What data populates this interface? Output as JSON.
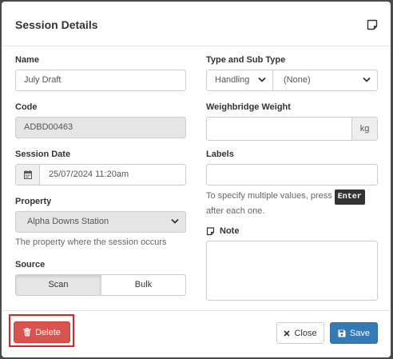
{
  "modal": {
    "title": "Session Details",
    "header_icon": "note-icon"
  },
  "left": {
    "name_label": "Name",
    "name_value": "July Draft",
    "code_label": "Code",
    "code_value": "ADBD00463",
    "session_date_label": "Session Date",
    "session_date_value": "25/07/2024 11:20am",
    "calendar_icon": "calendar-icon",
    "property_label": "Property",
    "property_value": "Alpha Downs Station",
    "property_help": "The property where the session occurs",
    "source_label": "Source",
    "source_options": [
      "Scan",
      "Bulk"
    ],
    "source_selected": "Scan"
  },
  "right": {
    "type_label": "Type and Sub Type",
    "type_value": "Handling",
    "subtype_value": "(None)",
    "weight_label": "Weighbridge Weight",
    "weight_value": "",
    "weight_unit": "kg",
    "labels_label": "Labels",
    "labels_value": "",
    "labels_help_pre": "To specify multiple values, press",
    "labels_help_key": "Enter",
    "labels_help_post": "after each one.",
    "note_label": "Note",
    "note_icon": "note-icon",
    "note_value": ""
  },
  "footer": {
    "delete_label": "Delete",
    "delete_icon": "trash-icon",
    "close_label": "Close",
    "close_icon": "x-icon",
    "save_label": "Save",
    "save_icon": "floppy-disk-icon"
  },
  "colors": {
    "delete": "#d9534f",
    "save": "#337ab7",
    "highlight": "#dd2222"
  }
}
